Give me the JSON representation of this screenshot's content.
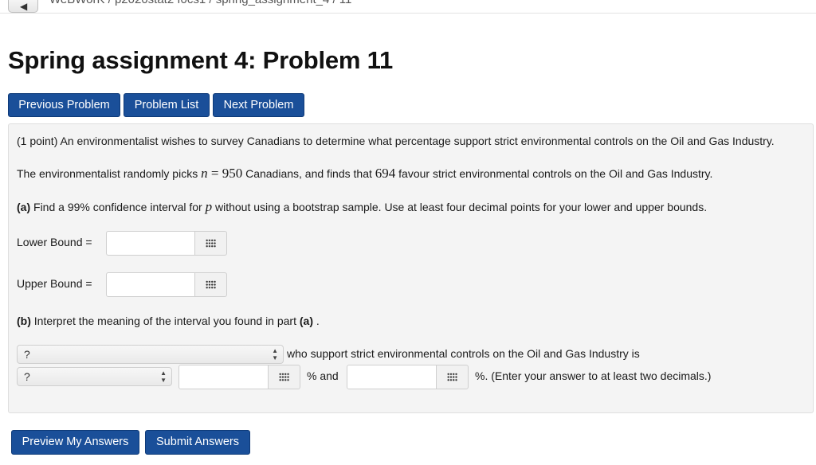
{
  "breadcrumb": "WeBWorK / p2020stat2 f0cs1 / spring_assignment_4 / 11",
  "back_icon": "chevron-left-icon",
  "page_title": "Spring assignment 4: Problem 11",
  "nav": {
    "previous": "Previous Problem",
    "list": "Problem List",
    "next": "Next Problem"
  },
  "problem": {
    "intro": "(1 point) An environmentalist wishes to survey Canadians to determine what percentage support strict environmental controls on the Oil and Gas Industry.",
    "sample_a": "The environmentalist randomly picks ",
    "n_var": "n",
    "n_eq": " = 950",
    "sample_b": " Canadians, and finds that ",
    "count": "694",
    "sample_c": " favour strict environmental controls on the Oil and Gas Industry.",
    "part_a_label": "(a)",
    "part_a_text_1": " Find a 99% confidence interval for ",
    "p_var": "p",
    "part_a_text_2": " without using a bootstrap sample. Use at least four decimal points for your lower and upper bounds.",
    "lower_label": "Lower Bound =",
    "lower_value": "",
    "upper_label": "Upper Bound =",
    "upper_value": "",
    "part_b_label": "(b)",
    "part_b_text_1": " Interpret the meaning of the interval you found in part ",
    "part_b_ref": "(a)",
    "part_b_text_2": " .",
    "select1_value": "?",
    "select1_suffix": "who support strict environmental controls on the Oil and Gas Industry is",
    "select2_value": "?",
    "interval_low_value": "",
    "between_text": "% and",
    "interval_high_value": "",
    "end_text": "%. (Enter your answer to at least two decimals.)"
  },
  "palette_icon": "equation-grid-icon",
  "buttons": {
    "preview": "Preview My Answers",
    "submit": "Submit Answers"
  },
  "colors": {
    "button_blue": "#1a4f99",
    "panel_bg": "#f4f4f4"
  }
}
